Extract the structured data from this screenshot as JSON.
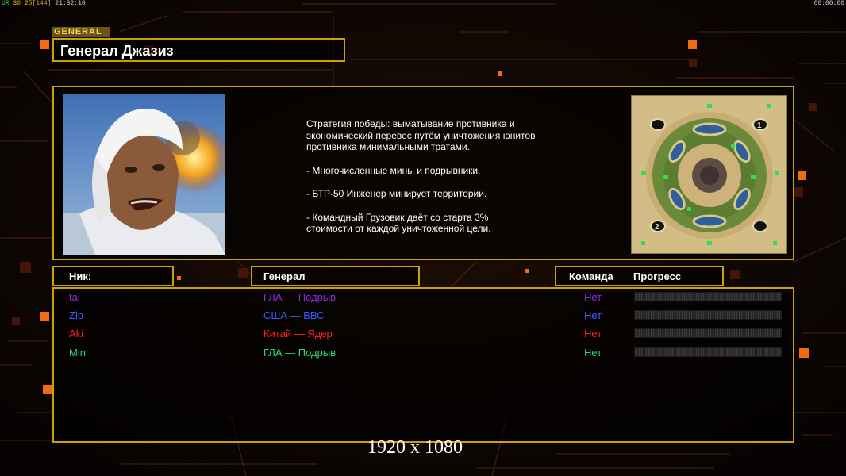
{
  "hud": {
    "left_ur": "UR",
    "left_a": "30",
    "left_b": "25",
    "left_c": "[144]",
    "left_time": "21:32:10",
    "right_time": "00:00:00"
  },
  "general": {
    "tag": "GENERAL",
    "name": "Генерал Джазиз"
  },
  "description": {
    "line1": "Стратегия победы: выматывание противника и\n экономический перевес путём уничтожения юнитов\n противника минимальными тратами.",
    "line2": "- Многочисленные мины и подрывники.",
    "line3": "- БТР-50 Инженер минирует территории.",
    "line4": "- Командный Грузовик даёт со старта 3%\n стоимости от каждой уничтоженной цели."
  },
  "minimap": {
    "start_1": "1",
    "start_2": "2"
  },
  "columns": {
    "nick": "Ник:",
    "general": "Генерал",
    "team": "Команда",
    "progress": "Прогресс"
  },
  "players": [
    {
      "nick": "tai",
      "general": "ГЛА — Подрыв",
      "team": "Нет",
      "progress": 0,
      "color": "#8a2be2"
    },
    {
      "nick": "Zlo",
      "general": "США — ВВС",
      "team": "Нет",
      "progress": 0,
      "color": "#3b5bff"
    },
    {
      "nick": "Aki",
      "general": "Китай — Ядер",
      "team": "Нет",
      "progress": 0,
      "color": "#ff2020"
    },
    {
      "nick": "Min",
      "general": "ГЛА — Подрыв",
      "team": "Нет",
      "progress": 0,
      "color": "#2ed67a"
    }
  ],
  "overlay": {
    "resolution": "1920 x 1080"
  },
  "colors": {
    "frame": "#c9a300",
    "accent": "#f26a12",
    "background": "#0d0603"
  }
}
